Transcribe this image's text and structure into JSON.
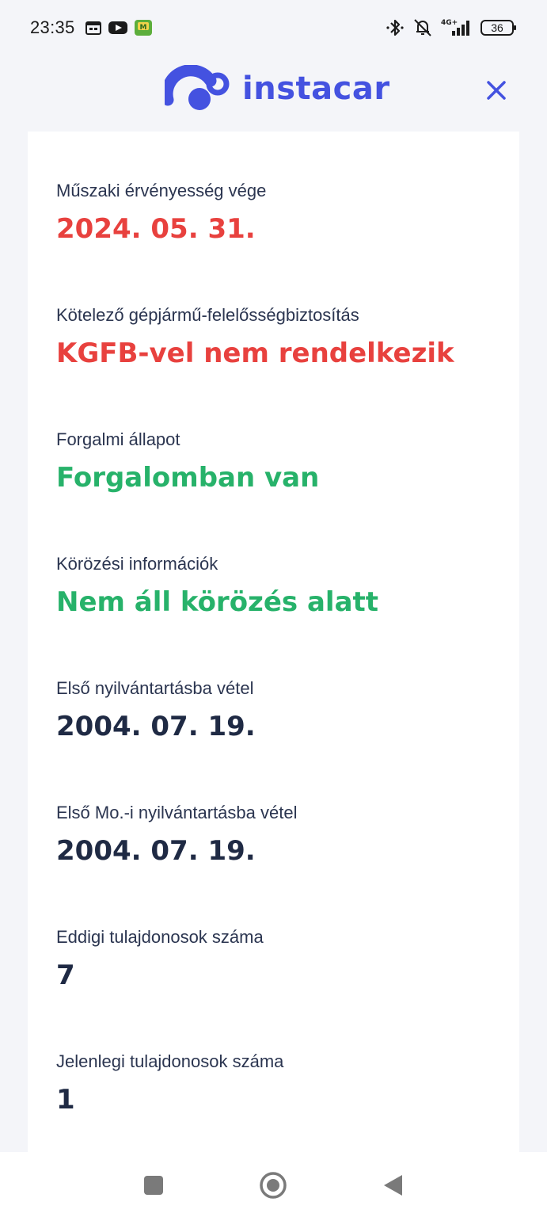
{
  "status_bar": {
    "time": "23:35",
    "network": "4G+",
    "battery": "36",
    "icons": [
      "calendar-icon",
      "youtube-icon",
      "app-notification-icon",
      "bluetooth-icon",
      "bell-muted-icon",
      "signal-icon",
      "battery-icon"
    ]
  },
  "header": {
    "brand": "instacar",
    "close_icon": "close-icon",
    "accent_color": "#4452e0"
  },
  "fields": [
    {
      "label": "Műszaki érvényesség vége",
      "value": "2024. 05. 31.",
      "status": "red"
    },
    {
      "label": "Kötelező gépjármű-felelősségbiztosítás",
      "value": "KGFB-vel nem rendelkezik",
      "status": "red"
    },
    {
      "label": "Forgalmi állapot",
      "value": "Forgalomban van",
      "status": "green"
    },
    {
      "label": "Körözési információk",
      "value": "Nem áll körözés alatt",
      "status": "green"
    },
    {
      "label": "Első nyilvántartásba vétel",
      "value": "2004. 07. 19.",
      "status": "default"
    },
    {
      "label": "Első Mo.-i nyilvántartásba vétel",
      "value": "2004. 07. 19.",
      "status": "default"
    },
    {
      "label": "Eddigi tulajdonosok száma",
      "value": "7",
      "status": "default"
    },
    {
      "label": "Jelenlegi tulajdonosok száma",
      "value": "1",
      "status": "default"
    }
  ],
  "colors": {
    "red": "#e8413e",
    "green": "#27b26a",
    "default": "#1f2a44"
  },
  "nav": {
    "icons": [
      "recents-square-icon",
      "home-circle-icon",
      "back-triangle-icon"
    ]
  }
}
